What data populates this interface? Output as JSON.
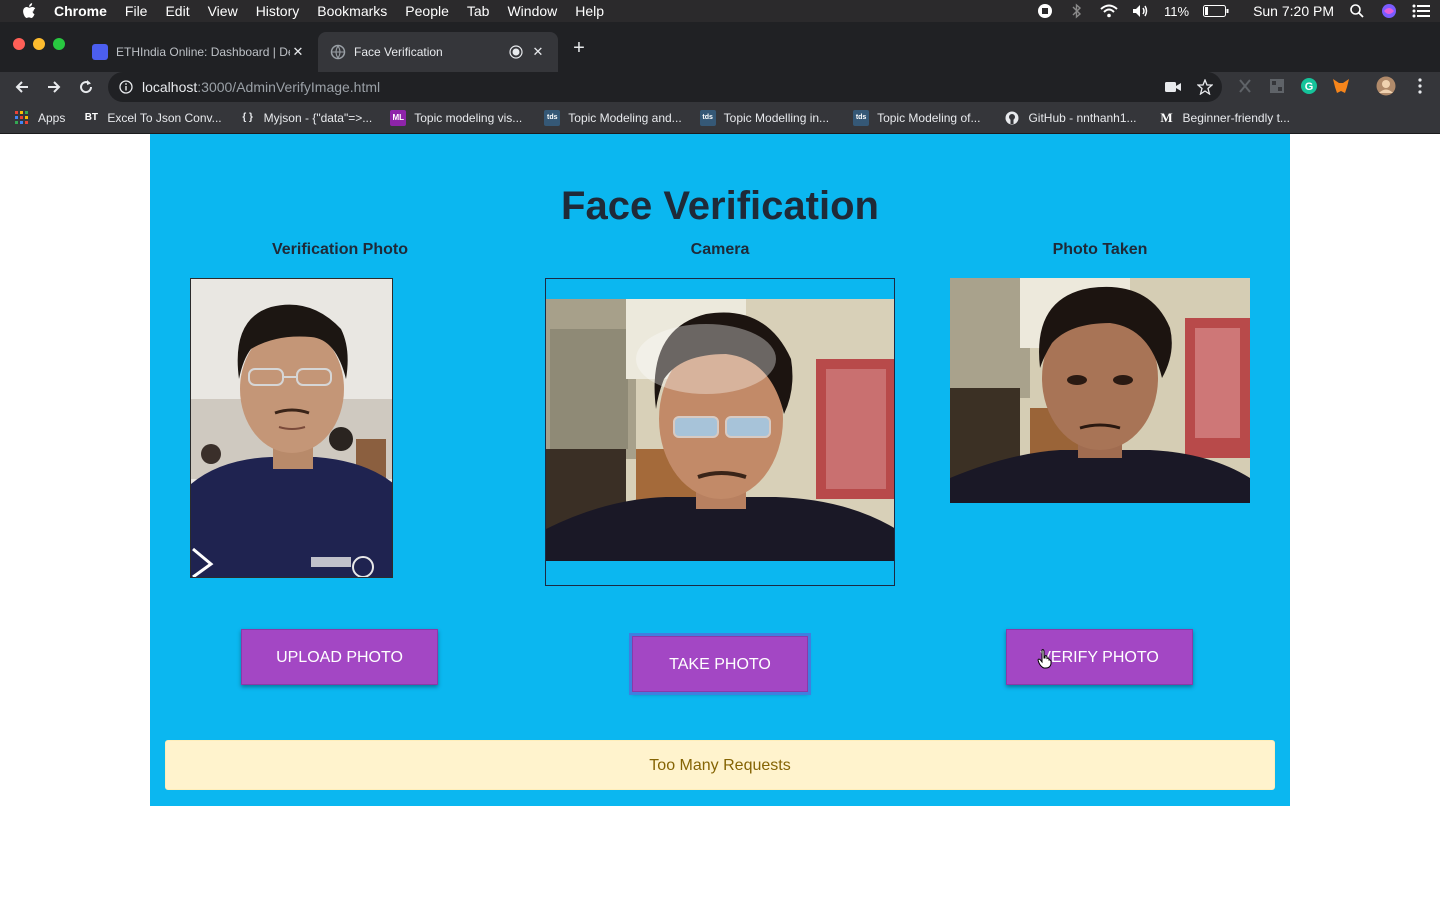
{
  "menubar": {
    "app_name": "Chrome",
    "items": [
      "File",
      "Edit",
      "View",
      "History",
      "Bookmarks",
      "People",
      "Tab",
      "Window",
      "Help"
    ],
    "battery": "11%",
    "clock": "Sun 7:20 PM"
  },
  "tabs": [
    {
      "title": "ETHIndia Online: Dashboard | De",
      "favicon_color": "#4b5ef0"
    },
    {
      "title": "Face Verification",
      "favicon_color": "#5f6368"
    }
  ],
  "address_bar": {
    "host": "localhost",
    "path": ":3000/AdminVerifyImage.html"
  },
  "bookmarks": [
    {
      "label": "Apps",
      "icon": "apps-grid-icon"
    },
    {
      "label": "Excel To Json Conv...",
      "icon": "bt-icon",
      "icon_text": "BT"
    },
    {
      "label": "Myjson - {\"data\"=>...",
      "icon": "braces-icon",
      "icon_text": "{ }"
    },
    {
      "label": "Topic modeling vis...",
      "icon": "ml-icon",
      "icon_text": "ML"
    },
    {
      "label": "Topic Modeling and...",
      "icon": "tds-icon",
      "icon_text": "tds"
    },
    {
      "label": "Topic Modelling in...",
      "icon": "tds-icon",
      "icon_text": "tds"
    },
    {
      "label": "Topic Modeling of...",
      "icon": "tds-icon",
      "icon_text": "tds"
    },
    {
      "label": "GitHub - nnthanh1...",
      "icon": "github-icon"
    },
    {
      "label": "Beginner-friendly t...",
      "icon": "medium-icon",
      "icon_text": "M"
    }
  ],
  "page": {
    "title": "Face Verification",
    "columns": {
      "verification": "Verification Photo",
      "camera": "Camera",
      "taken": "Photo Taken"
    },
    "buttons": {
      "upload": "UPLOAD PHOTO",
      "take": "TAKE PHOTO",
      "verify": "VERIFY PHOTO"
    },
    "alert": "Too Many Requests"
  },
  "colors": {
    "card_bg": "#0bb7f0",
    "button_bg": "#a347c4",
    "alert_bg": "#fff3cd",
    "alert_text": "#856404"
  }
}
